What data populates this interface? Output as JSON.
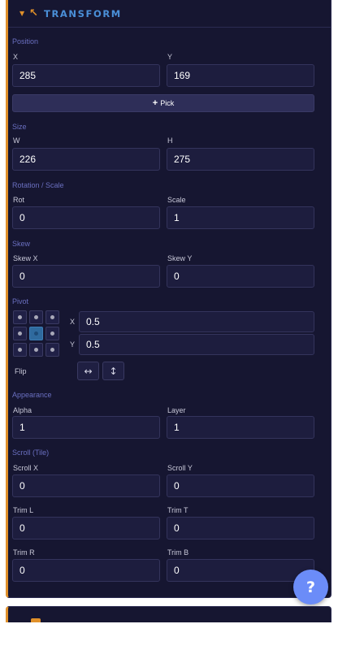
{
  "header": {
    "title": "TRANSFORM",
    "caret_icon": "caret-down-icon",
    "icon": "arrow-up-left-icon",
    "accent": "#e0902a",
    "title_color": "#4a8fd8"
  },
  "position": {
    "section": "Position",
    "x_label": "X",
    "x_value": "285",
    "y_label": "Y",
    "y_value": "169",
    "pick_icon": "plus-icon",
    "pick_label": "Pick"
  },
  "size": {
    "section": "Size",
    "w_label": "W",
    "w_value": "226",
    "h_label": "H",
    "h_value": "275"
  },
  "rotation_scale": {
    "section": "Rotation / Scale",
    "rot_label": "Rot",
    "rot_value": "0",
    "scale_label": "Scale",
    "scale_value": "1"
  },
  "skew": {
    "section": "Skew",
    "x_label": "Skew X",
    "x_value": "0",
    "y_label": "Skew Y",
    "y_value": "0"
  },
  "pivot": {
    "section": "Pivot",
    "x_label": "X",
    "x_value": "0.5",
    "y_label": "Y",
    "y_value": "0.5",
    "selected_cell": 4
  },
  "flip": {
    "label": "Flip",
    "horizontal_glyph": "↔",
    "vertical_glyph": "↕"
  },
  "appearance": {
    "section": "Appearance",
    "alpha_label": "Alpha",
    "alpha_value": "1",
    "layer_label": "Layer",
    "layer_value": "1"
  },
  "scroll": {
    "section": "Scroll (Tile)",
    "scroll_x_label": "Scroll X",
    "scroll_x_value": "0",
    "scroll_y_label": "Scroll Y",
    "scroll_y_value": "0",
    "trim_l_label": "Trim L",
    "trim_l_value": "0",
    "trim_t_label": "Trim T",
    "trim_t_value": "0",
    "trim_r_label": "Trim R",
    "trim_r_value": "0",
    "trim_b_label": "Trim B",
    "trim_b_value": "0"
  },
  "help": {
    "label": "?",
    "color": "#6b8cf8"
  }
}
